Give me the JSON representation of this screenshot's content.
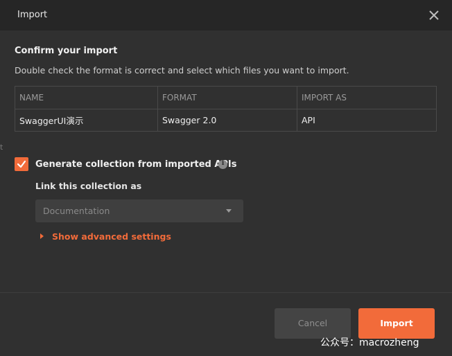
{
  "dialog": {
    "title": "Import",
    "close_icon": "close-icon"
  },
  "confirm": {
    "title": "Confirm your import",
    "description": "Double check the format is correct and select which files you want to import."
  },
  "table": {
    "headers": [
      "NAME",
      "FORMAT",
      "IMPORT AS"
    ],
    "rows": [
      [
        "SwaggerUI演示",
        "Swagger 2.0",
        "API"
      ]
    ]
  },
  "options": {
    "generate_collection_label": "Generate collection from imported APIs",
    "generate_collection_checked": true,
    "link_label": "Link this collection as",
    "link_select_value": "Documentation",
    "advanced_link": "Show advanced settings"
  },
  "footer": {
    "cancel_label": "Cancel",
    "import_label": "Import"
  },
  "watermark": "公众号：macrozheng",
  "edge_text": "t",
  "colors": {
    "accent": "#f26b3a",
    "background": "#303030",
    "header": "#262626"
  }
}
